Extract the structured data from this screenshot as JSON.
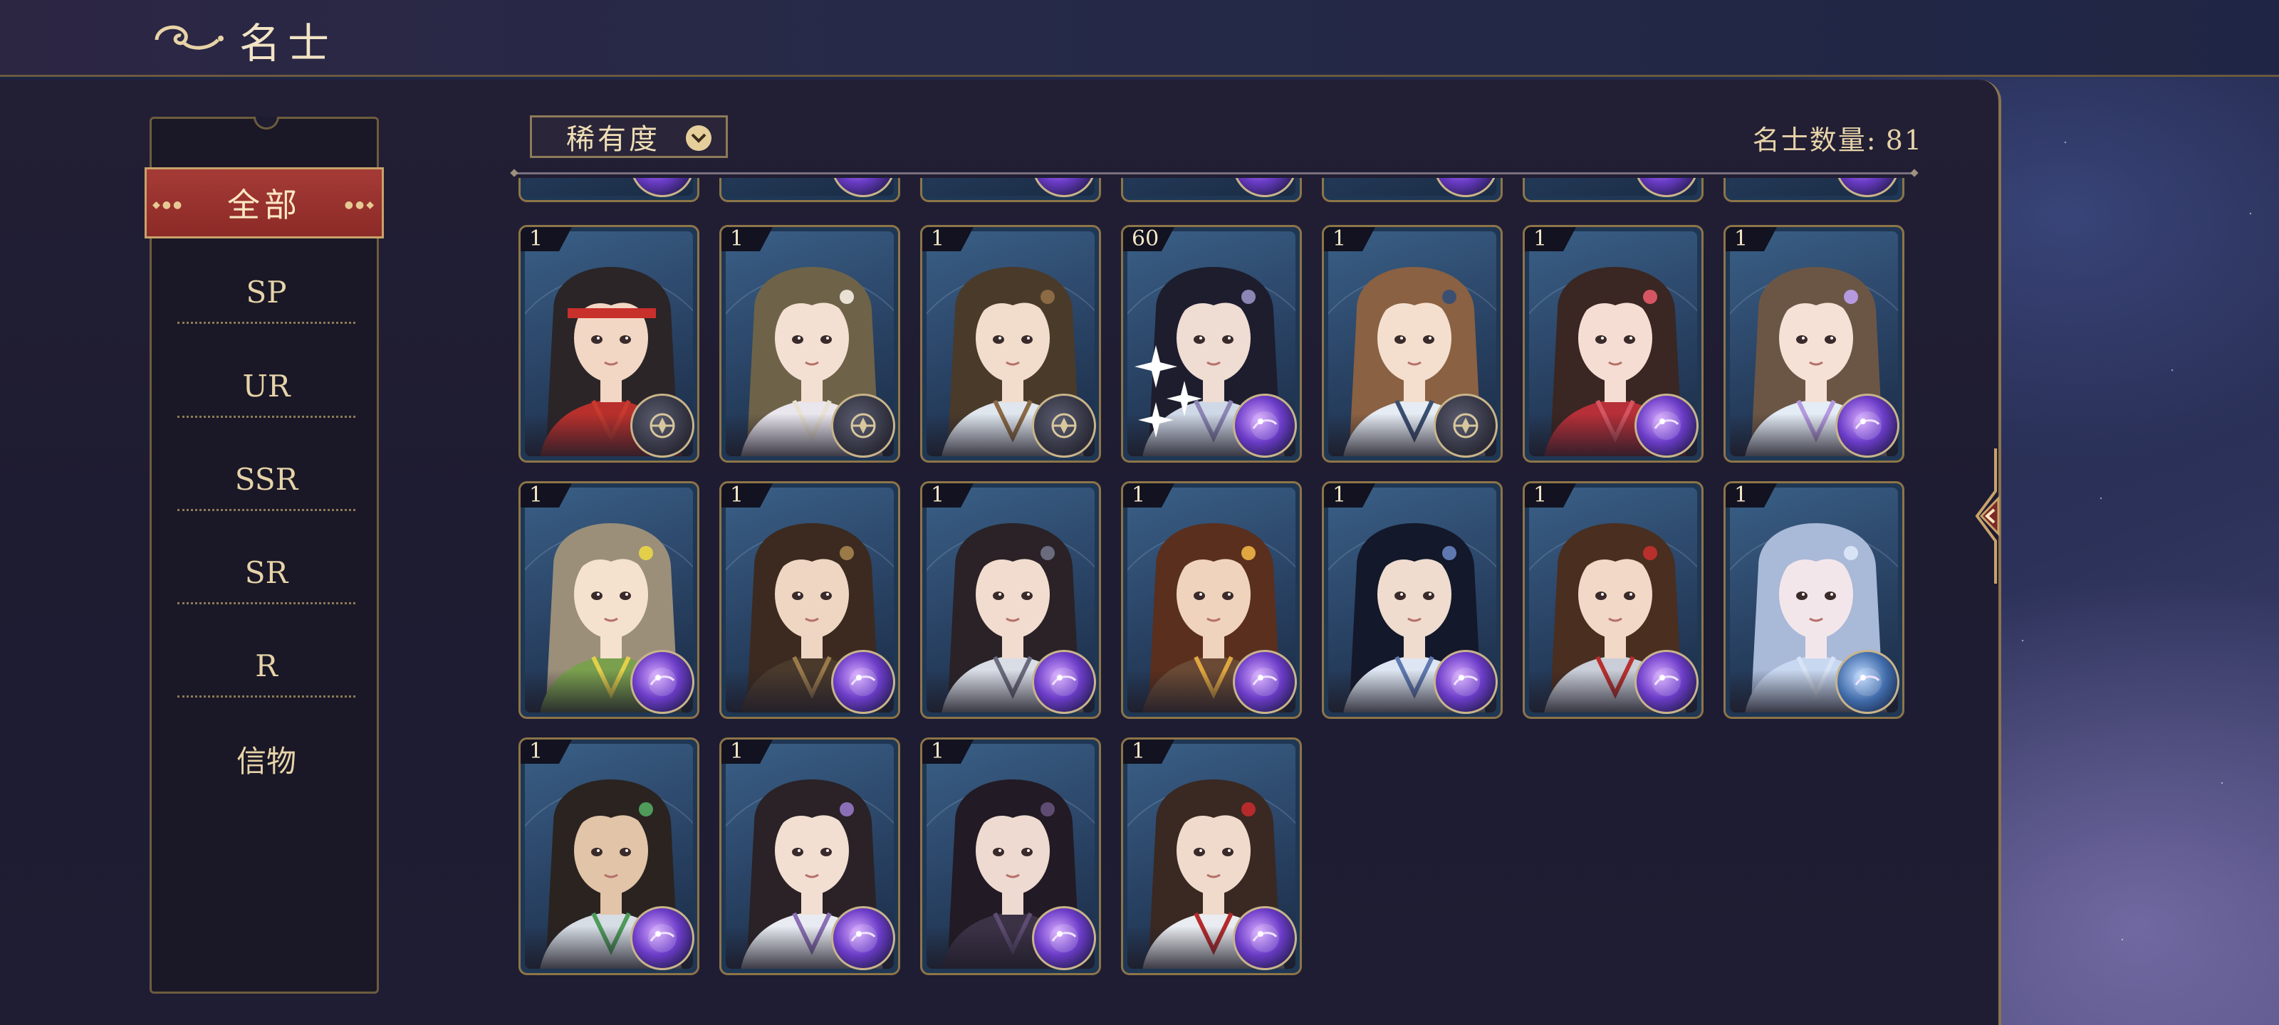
{
  "header": {
    "title": "名士",
    "logo_icon": "cloud-swirl-icon"
  },
  "sidebar": {
    "items": [
      {
        "label": "全部",
        "active": true
      },
      {
        "label": "SP",
        "active": false
      },
      {
        "label": "UR",
        "active": false
      },
      {
        "label": "SSR",
        "active": false
      },
      {
        "label": "SR",
        "active": false
      },
      {
        "label": "R",
        "active": false
      },
      {
        "label": "信物",
        "active": false
      }
    ]
  },
  "filter": {
    "label": "稀有度",
    "icon": "chevron-down-icon"
  },
  "count": {
    "label": "名士数量:",
    "value": "81"
  },
  "cards": [
    {
      "level": "1",
      "hair": "#2b2528",
      "skin": "#f2d7c4",
      "cloth": "#b8302c",
      "badge": "compass",
      "accent": "#c83a2e",
      "headband": true
    },
    {
      "level": "1",
      "hair": "#6e6348",
      "skin": "#f4e0d2",
      "cloth": "#e9e6ee",
      "badge": "compass",
      "accent": "#e9e2d4"
    },
    {
      "level": "1",
      "hair": "#4a3a2a",
      "skin": "#f2dccb",
      "cloth": "#dfe6ee",
      "badge": "compass",
      "accent": "#8b6a44"
    },
    {
      "level": "60",
      "hair": "#1d1d2e",
      "skin": "#efdcd2",
      "cloth": "#cfd8e6",
      "badge": "purple",
      "accent": "#8b86b5",
      "sparkles": true
    },
    {
      "level": "1",
      "hair": "#8a6142",
      "skin": "#f4dfcf",
      "cloth": "#e6ecf4",
      "badge": "compass",
      "accent": "#3b4f72"
    },
    {
      "level": "1",
      "hair": "#3a2622",
      "skin": "#f5ddd3",
      "cloth": "#b72f38",
      "badge": "purple",
      "accent": "#d55662"
    },
    {
      "level": "1",
      "hair": "#6b5645",
      "skin": "#f5e1d6",
      "cloth": "#e4ecf5",
      "badge": "purple",
      "accent": "#b59ae0"
    },
    {
      "level": "1",
      "hair": "#9b8f7a",
      "skin": "#f4e2cf",
      "cloth": "#7aa04e",
      "badge": "purple",
      "accent": "#e3d04a"
    },
    {
      "level": "1",
      "hair": "#3c2a20",
      "skin": "#eed6c2",
      "cloth": "#4a3a2c",
      "badge": "purple",
      "accent": "#9b7a4a"
    },
    {
      "level": "1",
      "hair": "#2a2226",
      "skin": "#f1dccf",
      "cloth": "#d9dde6",
      "badge": "purple",
      "accent": "#6b6b7e"
    },
    {
      "level": "1",
      "hair": "#5a2f1e",
      "skin": "#efd3bd",
      "cloth": "#6a4a34",
      "badge": "purple",
      "accent": "#e0a640"
    },
    {
      "level": "1",
      "hair": "#13182a",
      "skin": "#efdccf",
      "cloth": "#dde6f2",
      "badge": "purple",
      "accent": "#5f79b0"
    },
    {
      "level": "1",
      "hair": "#4a2e20",
      "skin": "#f2d8c6",
      "cloth": "#c9ced8",
      "badge": "purple",
      "accent": "#b8302c"
    },
    {
      "level": "1",
      "hair": "#a9b9d8",
      "skin": "#f3e6ea",
      "cloth": "#c8d8f0",
      "badge": "blue",
      "accent": "#d8e4f6"
    },
    {
      "level": "1",
      "hair": "#2a2320",
      "skin": "#e2c4a8",
      "cloth": "#d6dde4",
      "badge": "purple",
      "accent": "#4e9b5a"
    },
    {
      "level": "1",
      "hair": "#2a2226",
      "skin": "#f2dfd2",
      "cloth": "#e8ecf2",
      "badge": "purple",
      "accent": "#8b6fb6"
    },
    {
      "level": "1",
      "hair": "#221a24",
      "skin": "#eedad0",
      "cloth": "#3c3246",
      "badge": "purple",
      "accent": "#5e4c72"
    },
    {
      "level": "1",
      "hair": "#3a2822",
      "skin": "#f0dacb",
      "cloth": "#e9ecf0",
      "badge": "purple",
      "accent": "#b52b2b"
    }
  ],
  "colors": {
    "accent_red": "#a53b36",
    "gold": "#c8a26a",
    "panel": "#1e1c31"
  }
}
